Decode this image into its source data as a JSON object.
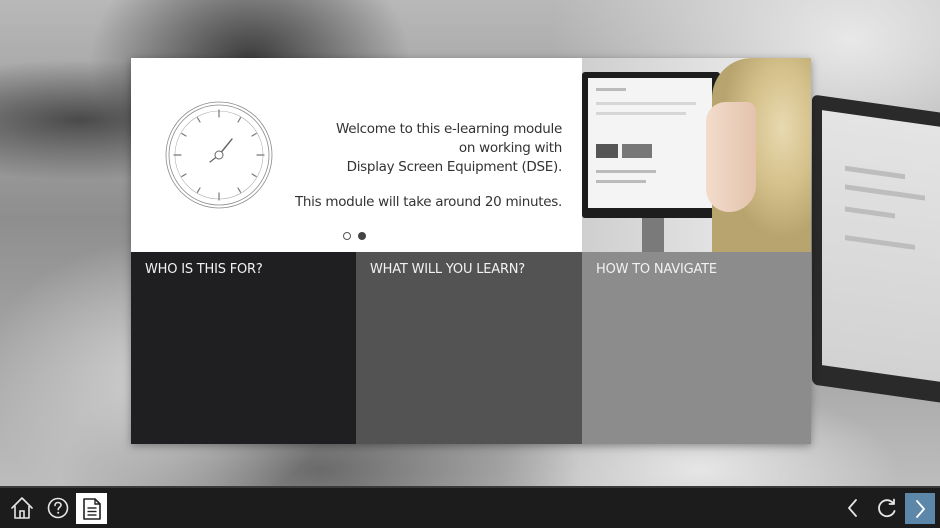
{
  "welcome": {
    "lines": [
      "Welcome to this e-learning module",
      "on working with",
      "Display Screen Equipment (DSE)."
    ],
    "duration": "This module will take around 20 minutes."
  },
  "slider": {
    "total": 2,
    "active": 2
  },
  "tiles": [
    {
      "title": "WHO IS THIS FOR?"
    },
    {
      "title": "WHAT WILL YOU LEARN?"
    },
    {
      "title": "HOW TO NAVIGATE"
    }
  ],
  "footer": {
    "left_icons": [
      "home-icon",
      "help-icon",
      "notes-icon"
    ],
    "right_icons": [
      "back-icon",
      "reload-icon",
      "next-icon"
    ],
    "accent": "#5d87a8"
  },
  "colors": {
    "tile_1": "#1f1f21",
    "tile_2": "#535353",
    "tile_3": "#8c8c8c",
    "footer": "#1c1c1c"
  }
}
